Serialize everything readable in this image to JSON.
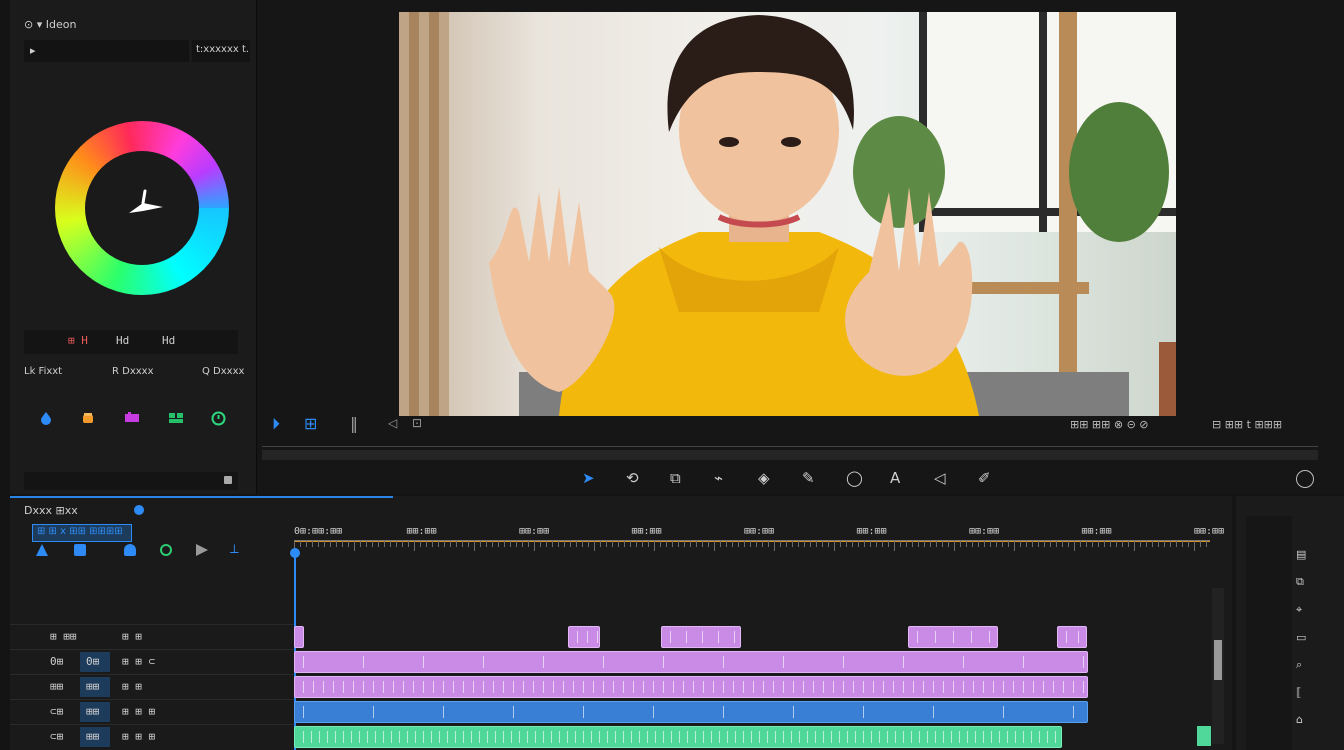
{
  "left_panel": {
    "header_label": "⊙ ▾ Ideon",
    "dropdown_value": "▸",
    "dropdown_right": "t:xxxxxx t.",
    "readouts": [
      "⊞ H",
      "Hd",
      "Hd"
    ],
    "buttons": [
      {
        "label": "Lk Fixxt",
        "icon": "lock-icon"
      },
      {
        "label": "R Dxxxx",
        "icon": "reset-icon"
      },
      {
        "label": "Q Dxxxx",
        "icon": "search-icon"
      }
    ],
    "tools": [
      {
        "icon": "droplet-icon",
        "color": "#2e8bf5"
      },
      {
        "icon": "bucket-icon",
        "color": "#f29b2a"
      },
      {
        "icon": "palette-icon",
        "color": "#c63ce0"
      },
      {
        "icon": "grid-icon",
        "color": "#27c06a"
      },
      {
        "icon": "clock-icon",
        "color": "#2ed67e"
      }
    ]
  },
  "preview": {
    "toolbar_left": [
      "⏵",
      "⊞",
      "‖",
      "◁",
      "⊡"
    ],
    "toolbar_right_text": "⊞⊞ ⊞⊞ ⊗ ⊝ ⊘",
    "toolbar_right_label": "⊟ ⊞⊞ t ⊞⊞⊞",
    "tools": [
      "➤",
      "⟲",
      "⧉",
      "⌁",
      "◈",
      "✎",
      "◯",
      "A",
      "◁",
      "✐"
    ],
    "selected_tool": 0,
    "accent": "#2e8bf5"
  },
  "timeline": {
    "title": "Dxxx ⊞xx",
    "badge": "⊞ ⊞ x ⊞⊞ ⊞⊞⊞⊞",
    "timecodes": [
      "0⊞:⊞⊞:⊞⊞",
      "⊞⊞:⊞⊞",
      "⊞⊞:⊞⊞",
      "⊞⊞:⊞⊞",
      "⊞⊞:⊞⊞",
      "⊞⊞:⊞⊞",
      "⊞⊞:⊞⊞",
      "⊞⊞:⊞⊞",
      "⊞⊞:⊞⊞"
    ],
    "tracks": [
      {
        "name": "⊞ ⊞⊞",
        "left_val": "",
        "right": "⊞ ⊞"
      },
      {
        "name": "0⊞",
        "left_val": "0⊞",
        "right": "⊞ ⊞ ⊂"
      },
      {
        "name": "⊞⊞",
        "left_val": "⊞⊞",
        "right": "⊞ ⊞"
      },
      {
        "name": "⊂⊞",
        "left_val": "⊞⊞",
        "right": "⊞ ⊞ ⊞"
      },
      {
        "name": "⊂⊞",
        "left_val": "⊞⊞",
        "right": "⊞ ⊞ ⊞"
      }
    ],
    "colors": {
      "purple": "#c98be6",
      "blue": "#3a7fd6",
      "green": "#4fd89a"
    }
  },
  "right_strip": {
    "icons": [
      "list-icon",
      "copy-icon",
      "pin-icon",
      "chat-icon",
      "filter-icon",
      "bracket-icon",
      "lock-icon",
      "image-icon"
    ]
  }
}
